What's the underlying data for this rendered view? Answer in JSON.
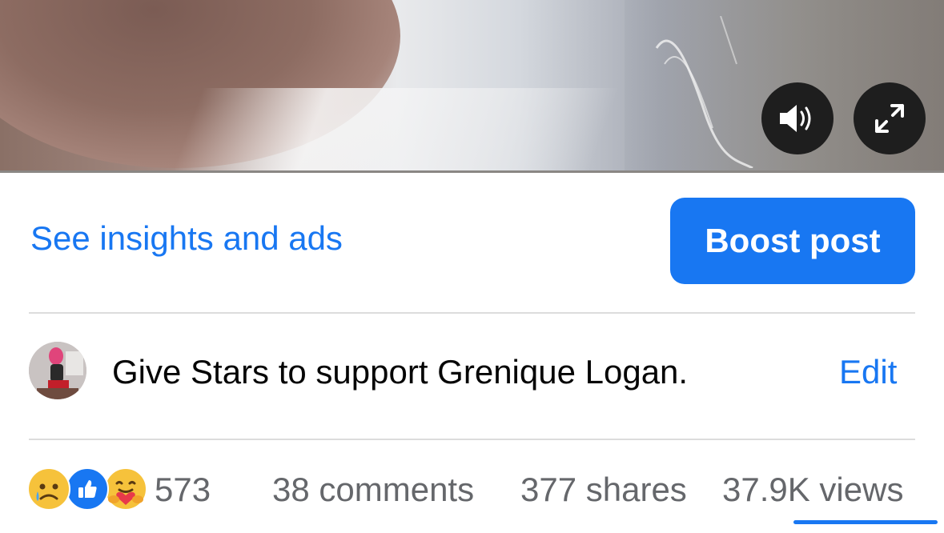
{
  "video": {
    "sound_icon": "speaker-on-icon",
    "fullscreen_icon": "expand-icon"
  },
  "actions": {
    "insights_label": "See insights and ads",
    "boost_label": "Boost post"
  },
  "stars": {
    "text": "Give Stars to support Grenique Logan.",
    "edit_label": "Edit"
  },
  "stats": {
    "reactions": [
      "sad-reaction-icon",
      "like-reaction-icon",
      "care-reaction-icon"
    ],
    "reaction_count": "573",
    "comments": "38 comments",
    "shares": "377 shares",
    "views": "37.9K views"
  },
  "colors": {
    "accent": "#1877f2",
    "secondary_text": "#65676b"
  }
}
